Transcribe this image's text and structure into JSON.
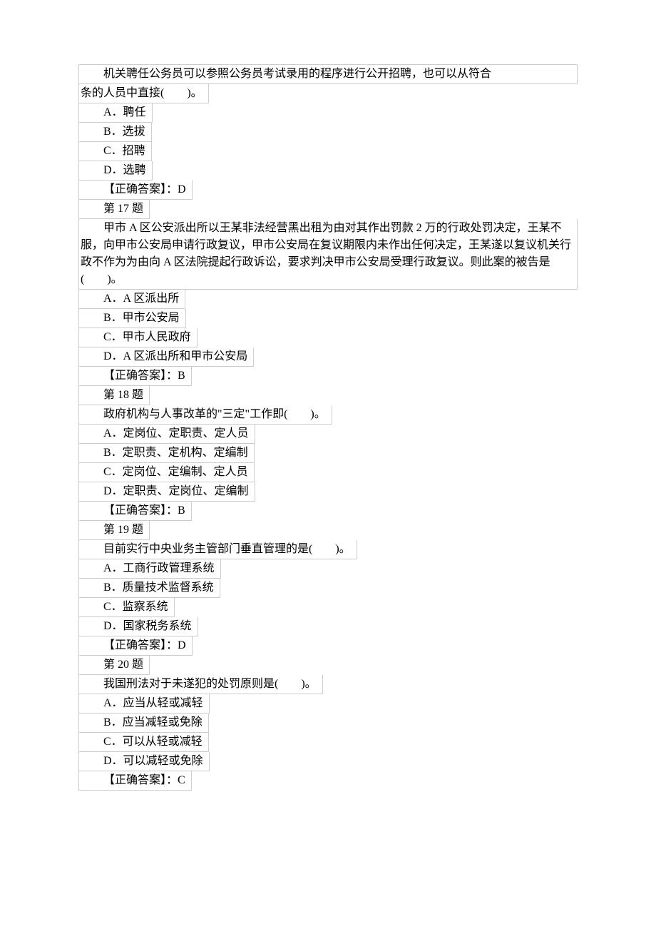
{
  "q16": {
    "stem_line1": "　　机关聘任公务员可以参照公务员考试录用的程序进行公开招聘，也可以从符合",
    "stem_line2": "条的人员中直接(　　)。",
    "optA": "A．聘任",
    "optB": "B．选拔",
    "optC": "C．招聘",
    "optD": "D．选聘",
    "answer": "【正确答案】：D"
  },
  "q17": {
    "title": "第 17 题",
    "stem": "　　甲市 A 区公安派出所以王某非法经营黑出租为由对其作出罚款 2 万的行政处罚决定，王某不服，向甲市公安局申请行政复议，甲市公安局在复议期限内未作出任何决定，王某遂以复议机关行政不作为为由向 A 区法院提起行政诉讼，要求判决甲市公安局受理行政复议。则此案的被告是(　　)。",
    "optA": "A．A 区派出所",
    "optB": "B．甲市公安局",
    "optC": "C．甲市人民政府",
    "optD": "D．A 区派出所和甲市公安局",
    "answer": "【正确答案】：B"
  },
  "q18": {
    "title": "第 18 题",
    "stem": "政府机构与人事改革的\"三定\"工作即(　　)。",
    "optA": "A．定岗位、定职责、定人员",
    "optB": "B．定职责、定机构、定编制",
    "optC": "C．定岗位、定编制、定人员",
    "optD": "D．定职责、定岗位、定编制",
    "answer": "【正确答案】：B"
  },
  "q19": {
    "title": "第 19 题",
    "stem": "目前实行中央业务主管部门垂直管理的是(　　)。",
    "optA": "A．工商行政管理系统",
    "optB": "B．质量技术监督系统",
    "optC": "C．监察系统",
    "optD": "D．国家税务系统",
    "answer": "【正确答案】：D"
  },
  "q20": {
    "title": "第 20 题",
    "stem": "我国刑法对于未遂犯的处罚原则是(　　)。",
    "optA": "A．应当从轻或减轻",
    "optB": "B．应当减轻或免除",
    "optC": "C．可以从轻或减轻",
    "optD": "D．可以减轻或免除",
    "answer": "【正确答案】：C"
  }
}
